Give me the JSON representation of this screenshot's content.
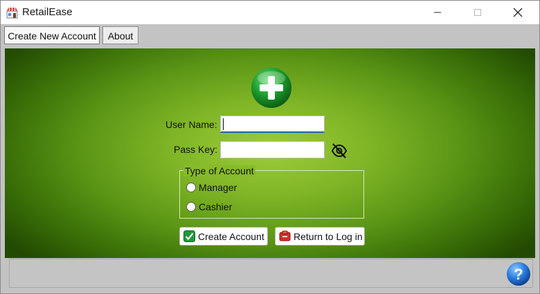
{
  "window": {
    "title": "RetailEase",
    "controls": {
      "minimize": "minimize",
      "maximize": "maximize",
      "close": "close"
    }
  },
  "tabs": [
    {
      "label": "Create New Account",
      "selected": true
    },
    {
      "label": "About",
      "selected": false
    }
  ],
  "form": {
    "username_label": "User Name:",
    "username_value": "",
    "passkey_label": "Pass Key:",
    "passkey_value": "",
    "account_type": {
      "title": "Type of Account",
      "options": [
        "Manager",
        "Cashier"
      ],
      "selected": null
    }
  },
  "buttons": {
    "create": "Create Account",
    "return": "Return to Log in"
  },
  "icons": {
    "app": "store-icon",
    "header": "add-plus-icon",
    "password_toggle": "eye-off-icon",
    "create": "checkmark-icon",
    "return": "door-exit-icon",
    "help": "help-icon"
  },
  "colors": {
    "panel_green": "#7fb526",
    "accent_blue": "#1e5fb5",
    "help_blue": "#2a7be0"
  }
}
